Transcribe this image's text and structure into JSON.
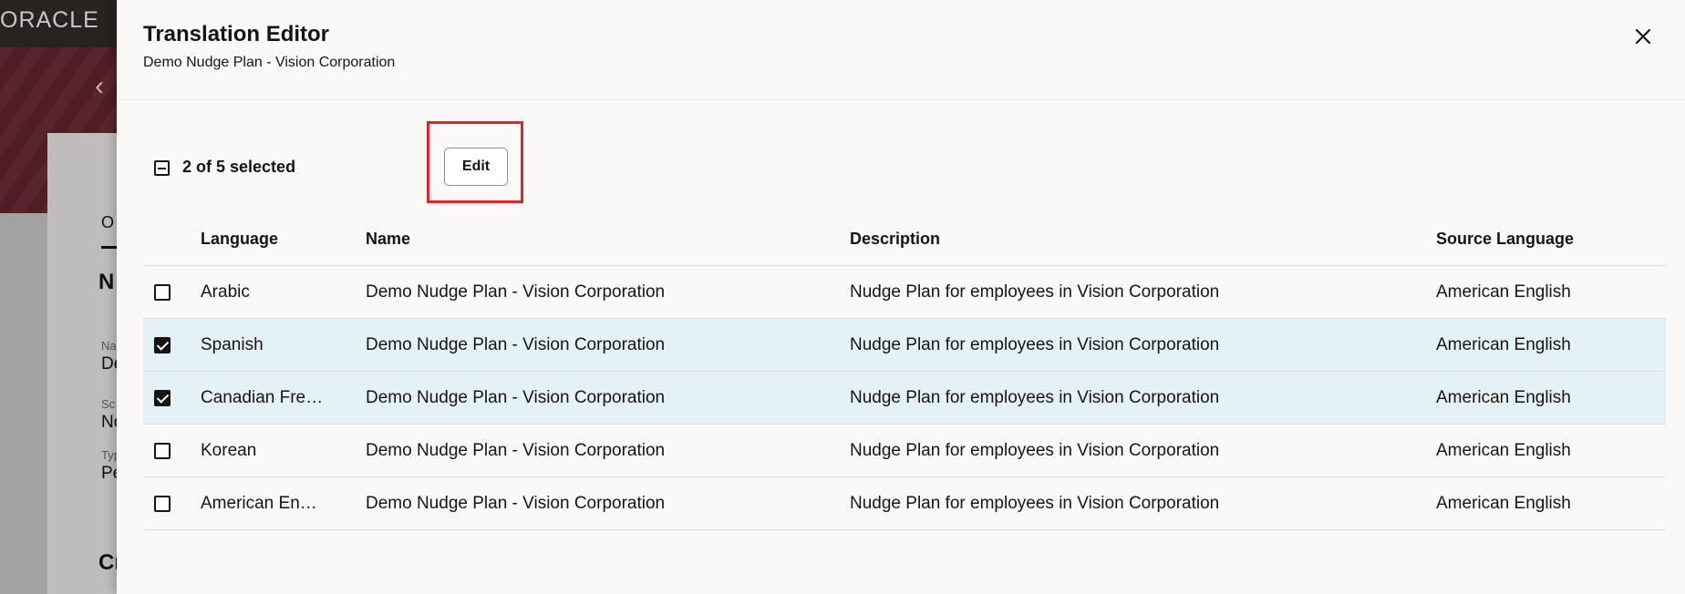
{
  "background": {
    "logo": "ORACLE",
    "tab_fragment": "O",
    "heading_fragment": "N",
    "fields": [
      {
        "label": "Na",
        "value": "De"
      },
      {
        "label": "Sc",
        "value": "No"
      },
      {
        "label": "Typ",
        "value": "Pe"
      }
    ],
    "heading2_fragment": "Cr"
  },
  "drawer": {
    "title": "Translation Editor",
    "subtitle": "Demo Nudge Plan - Vision Corporation",
    "close_icon": "close-icon"
  },
  "toolbar": {
    "selection_text": "2 of 5 selected",
    "edit_label": "Edit"
  },
  "table": {
    "columns": [
      "Language",
      "Name",
      "Description",
      "Source Language"
    ],
    "rows": [
      {
        "checked": false,
        "language": "Arabic",
        "name": "Demo Nudge Plan - Vision Corporation",
        "description": "Nudge Plan for employees in Vision Corporation",
        "source": "American English"
      },
      {
        "checked": true,
        "language": "Spanish",
        "name": "Demo Nudge Plan - Vision Corporation",
        "description": "Nudge Plan for employees in Vision Corporation",
        "source": "American English"
      },
      {
        "checked": true,
        "language": "Canadian Fre…",
        "name": "Demo Nudge Plan - Vision Corporation",
        "description": "Nudge Plan for employees in Vision Corporation",
        "source": "American English"
      },
      {
        "checked": false,
        "language": "Korean",
        "name": "Demo Nudge Plan - Vision Corporation",
        "description": "Nudge Plan for employees in Vision Corporation",
        "source": "American English"
      },
      {
        "checked": false,
        "language": "American En…",
        "name": "Demo Nudge Plan - Vision Corporation",
        "description": "Nudge Plan for employees in Vision Corporation",
        "source": "American English"
      }
    ]
  },
  "colors": {
    "selected_row": "#e4f1f7",
    "highlight": "#e1242b",
    "hero": "#6b2832",
    "topbar": "#312d2a"
  }
}
